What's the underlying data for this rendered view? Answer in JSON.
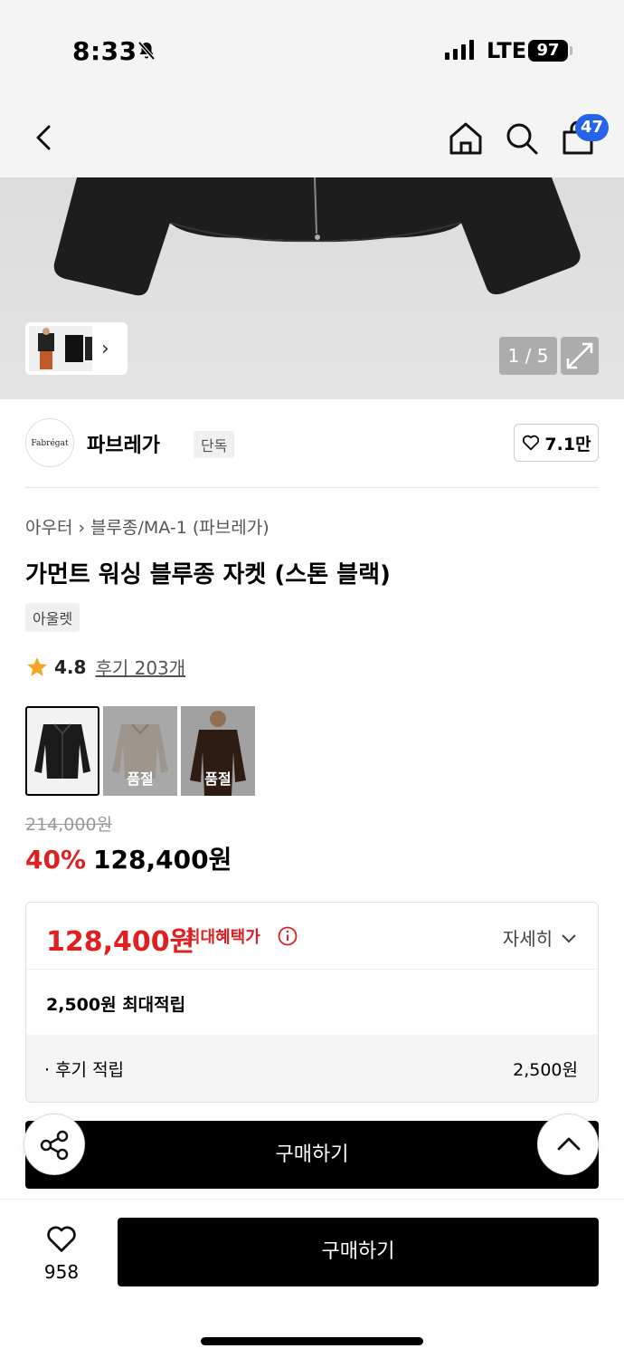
{
  "status_bar": {
    "time": "8:33",
    "network": "LTE",
    "battery": "97"
  },
  "nav": {
    "cart_count": "47"
  },
  "gallery": {
    "counter": "1 / 5"
  },
  "brand": {
    "logo_text": "Fabrégat",
    "name": "파브레가",
    "tag": "단독",
    "likes": "7.1만"
  },
  "breadcrumb": {
    "category": "아우터",
    "subcategory": "블루종/MA-1 (파브레가)"
  },
  "product": {
    "title": "가먼트 워싱 블루종 자켓 (스톤 블랙)",
    "outlet_tag": "아울렛",
    "rating": "4.8",
    "reviews": "후기 203개"
  },
  "colors": [
    {
      "name": "black",
      "sold_out": ""
    },
    {
      "name": "beige",
      "sold_out": "품절"
    },
    {
      "name": "brown",
      "sold_out": "품절"
    }
  ],
  "price": {
    "original": "214,000원",
    "discount_pct": "40%",
    "sale": "128,400원"
  },
  "benefit": {
    "max_price": "128,400원",
    "max_label": "최대혜택가",
    "detail_label": "자세히",
    "points": "2,500원 최대적립",
    "review_label": "· 후기 적립",
    "review_value": "2,500원"
  },
  "buttons": {
    "buy_inline": "구매하기",
    "buy_main": "구매하기"
  },
  "bottom": {
    "wish_count": "958"
  },
  "colors_theme": {
    "accent_red": "#e02020",
    "badge_blue": "#2563eb"
  }
}
